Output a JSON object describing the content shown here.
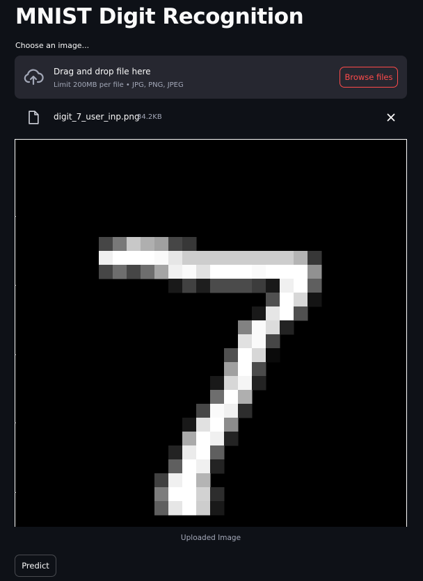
{
  "title": "MNIST Digit Recognition",
  "uploader": {
    "label": "Choose an image...",
    "drop_title": "Drag and drop file here",
    "drop_limit": "Limit 200MB per file • JPG, PNG, JPEG",
    "browse_label": "Browse files",
    "icon": "cloud-upload-icon"
  },
  "file": {
    "name": "digit_7_user_inp.png",
    "size": "34.2KB",
    "icon": "file-icon",
    "remove_icon": "close-icon"
  },
  "image": {
    "caption": "Uploaded Image",
    "grid_size": 28,
    "pixels": [
      {
        "r": 7,
        "c": 6,
        "v": 70
      },
      {
        "r": 7,
        "c": 7,
        "v": 120
      },
      {
        "r": 7,
        "c": 8,
        "v": 200
      },
      {
        "r": 7,
        "c": 9,
        "v": 175
      },
      {
        "r": 7,
        "c": 10,
        "v": 160
      },
      {
        "r": 7,
        "c": 11,
        "v": 70
      },
      {
        "r": 7,
        "c": 12,
        "v": 55
      },
      {
        "r": 8,
        "c": 6,
        "v": 240
      },
      {
        "r": 8,
        "c": 7,
        "v": 255
      },
      {
        "r": 8,
        "c": 8,
        "v": 255
      },
      {
        "r": 8,
        "c": 9,
        "v": 255
      },
      {
        "r": 8,
        "c": 10,
        "v": 250
      },
      {
        "r": 8,
        "c": 11,
        "v": 230
      },
      {
        "r": 8,
        "c": 12,
        "v": 205
      },
      {
        "r": 8,
        "c": 13,
        "v": 205
      },
      {
        "r": 8,
        "c": 14,
        "v": 205
      },
      {
        "r": 8,
        "c": 15,
        "v": 205
      },
      {
        "r": 8,
        "c": 16,
        "v": 205
      },
      {
        "r": 8,
        "c": 17,
        "v": 205
      },
      {
        "r": 8,
        "c": 18,
        "v": 205
      },
      {
        "r": 8,
        "c": 19,
        "v": 205
      },
      {
        "r": 8,
        "c": 20,
        "v": 180
      },
      {
        "r": 8,
        "c": 21,
        "v": 55
      },
      {
        "r": 9,
        "c": 6,
        "v": 70
      },
      {
        "r": 9,
        "c": 7,
        "v": 110
      },
      {
        "r": 9,
        "c": 8,
        "v": 70
      },
      {
        "r": 9,
        "c": 9,
        "v": 110
      },
      {
        "r": 9,
        "c": 10,
        "v": 165
      },
      {
        "r": 9,
        "c": 11,
        "v": 240
      },
      {
        "r": 9,
        "c": 12,
        "v": 250
      },
      {
        "r": 9,
        "c": 13,
        "v": 225
      },
      {
        "r": 9,
        "c": 14,
        "v": 255
      },
      {
        "r": 9,
        "c": 15,
        "v": 255
      },
      {
        "r": 9,
        "c": 16,
        "v": 255
      },
      {
        "r": 9,
        "c": 17,
        "v": 250
      },
      {
        "r": 9,
        "c": 18,
        "v": 255
      },
      {
        "r": 9,
        "c": 19,
        "v": 255
      },
      {
        "r": 9,
        "c": 20,
        "v": 255
      },
      {
        "r": 9,
        "c": 21,
        "v": 145
      },
      {
        "r": 10,
        "c": 11,
        "v": 25
      },
      {
        "r": 10,
        "c": 12,
        "v": 65
      },
      {
        "r": 10,
        "c": 13,
        "v": 30
      },
      {
        "r": 10,
        "c": 14,
        "v": 75
      },
      {
        "r": 10,
        "c": 15,
        "v": 75
      },
      {
        "r": 10,
        "c": 16,
        "v": 75
      },
      {
        "r": 10,
        "c": 17,
        "v": 60
      },
      {
        "r": 10,
        "c": 18,
        "v": 25
      },
      {
        "r": 10,
        "c": 19,
        "v": 240
      },
      {
        "r": 10,
        "c": 20,
        "v": 255
      },
      {
        "r": 10,
        "c": 21,
        "v": 95
      },
      {
        "r": 11,
        "c": 18,
        "v": 80
      },
      {
        "r": 11,
        "c": 19,
        "v": 255
      },
      {
        "r": 11,
        "c": 20,
        "v": 215
      },
      {
        "r": 11,
        "c": 21,
        "v": 20
      },
      {
        "r": 12,
        "c": 17,
        "v": 25
      },
      {
        "r": 12,
        "c": 18,
        "v": 230
      },
      {
        "r": 12,
        "c": 19,
        "v": 255
      },
      {
        "r": 12,
        "c": 20,
        "v": 80
      },
      {
        "r": 13,
        "c": 16,
        "v": 130
      },
      {
        "r": 13,
        "c": 17,
        "v": 250
      },
      {
        "r": 13,
        "c": 18,
        "v": 220
      },
      {
        "r": 13,
        "c": 19,
        "v": 35
      },
      {
        "r": 14,
        "c": 16,
        "v": 225
      },
      {
        "r": 14,
        "c": 17,
        "v": 250
      },
      {
        "r": 14,
        "c": 18,
        "v": 70
      },
      {
        "r": 15,
        "c": 15,
        "v": 80
      },
      {
        "r": 15,
        "c": 16,
        "v": 255
      },
      {
        "r": 15,
        "c": 17,
        "v": 215
      },
      {
        "r": 15,
        "c": 18,
        "v": 10
      },
      {
        "r": 16,
        "c": 15,
        "v": 160
      },
      {
        "r": 16,
        "c": 16,
        "v": 255
      },
      {
        "r": 16,
        "c": 17,
        "v": 75
      },
      {
        "r": 17,
        "c": 14,
        "v": 25
      },
      {
        "r": 17,
        "c": 15,
        "v": 215
      },
      {
        "r": 17,
        "c": 16,
        "v": 245
      },
      {
        "r": 17,
        "c": 17,
        "v": 35
      },
      {
        "r": 18,
        "c": 14,
        "v": 110
      },
      {
        "r": 18,
        "c": 15,
        "v": 255
      },
      {
        "r": 18,
        "c": 16,
        "v": 175
      },
      {
        "r": 19,
        "c": 13,
        "v": 70
      },
      {
        "r": 19,
        "c": 14,
        "v": 250
      },
      {
        "r": 19,
        "c": 15,
        "v": 240
      },
      {
        "r": 19,
        "c": 16,
        "v": 45
      },
      {
        "r": 20,
        "c": 12,
        "v": 25
      },
      {
        "r": 20,
        "c": 13,
        "v": 225
      },
      {
        "r": 20,
        "c": 14,
        "v": 255
      },
      {
        "r": 20,
        "c": 15,
        "v": 140
      },
      {
        "r": 21,
        "c": 12,
        "v": 170
      },
      {
        "r": 21,
        "c": 13,
        "v": 255
      },
      {
        "r": 21,
        "c": 14,
        "v": 240
      },
      {
        "r": 21,
        "c": 15,
        "v": 35
      },
      {
        "r": 22,
        "c": 11,
        "v": 35
      },
      {
        "r": 22,
        "c": 12,
        "v": 235
      },
      {
        "r": 22,
        "c": 13,
        "v": 255
      },
      {
        "r": 22,
        "c": 14,
        "v": 95
      },
      {
        "r": 23,
        "c": 11,
        "v": 95
      },
      {
        "r": 23,
        "c": 12,
        "v": 255
      },
      {
        "r": 23,
        "c": 13,
        "v": 240
      },
      {
        "r": 23,
        "c": 14,
        "v": 35
      },
      {
        "r": 24,
        "c": 10,
        "v": 65
      },
      {
        "r": 24,
        "c": 11,
        "v": 240
      },
      {
        "r": 24,
        "c": 12,
        "v": 255
      },
      {
        "r": 24,
        "c": 13,
        "v": 180
      },
      {
        "r": 25,
        "c": 10,
        "v": 125
      },
      {
        "r": 25,
        "c": 11,
        "v": 255
      },
      {
        "r": 25,
        "c": 12,
        "v": 255
      },
      {
        "r": 25,
        "c": 13,
        "v": 210
      },
      {
        "r": 25,
        "c": 14,
        "v": 45
      },
      {
        "r": 26,
        "c": 10,
        "v": 95
      },
      {
        "r": 26,
        "c": 11,
        "v": 230
      },
      {
        "r": 26,
        "c": 12,
        "v": 255
      },
      {
        "r": 26,
        "c": 13,
        "v": 205
      },
      {
        "r": 26,
        "c": 14,
        "v": 25
      }
    ]
  },
  "actions": {
    "predict_label": "Predict"
  },
  "colors": {
    "background": "#0e1117",
    "panel": "#262730",
    "accent": "#ff4b4b",
    "muted_text": "#a3a8b8"
  }
}
